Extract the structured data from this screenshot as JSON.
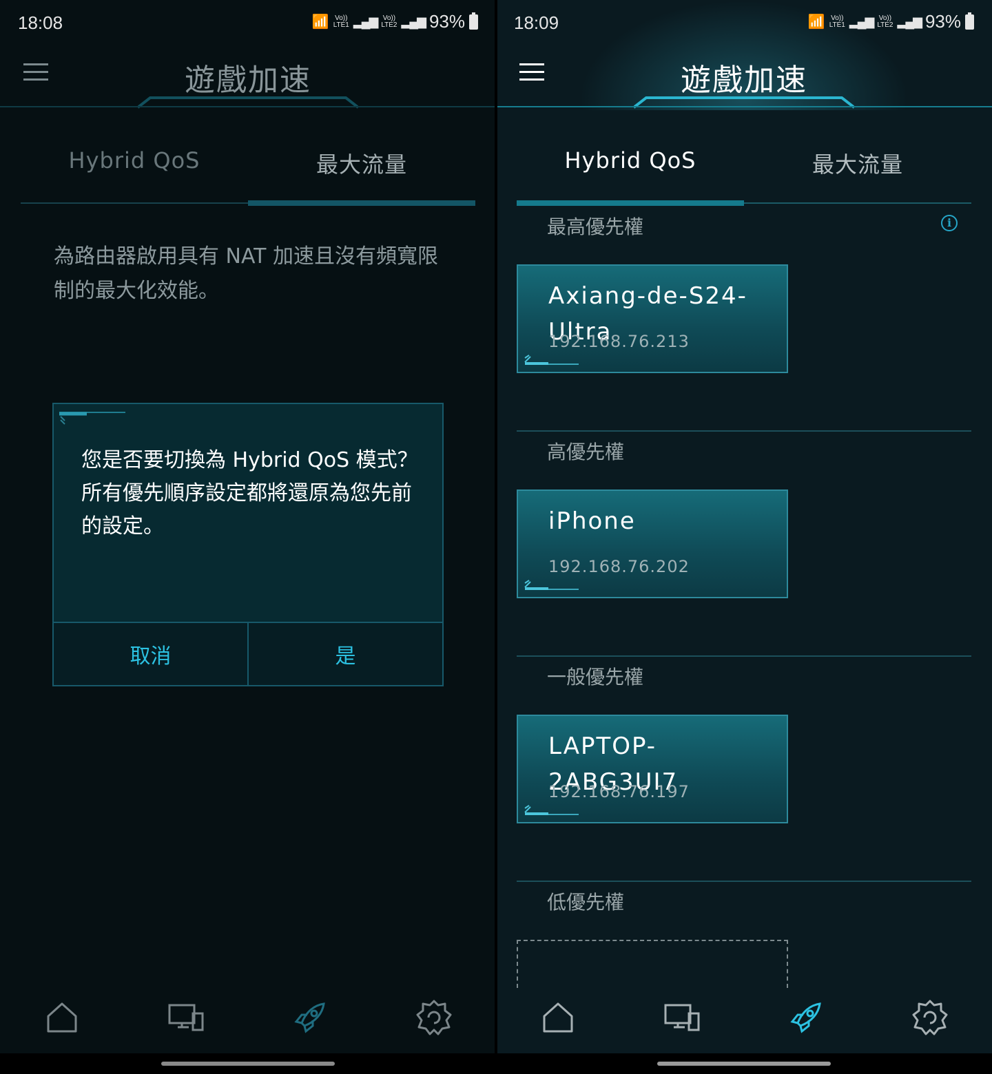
{
  "left": {
    "status": {
      "time": "18:08",
      "net1": [
        "Vo))",
        "LTE1"
      ],
      "net2": [
        "Vo))",
        "LTE2"
      ],
      "battery": "93%"
    },
    "header": {
      "title": "遊戲加速"
    },
    "tabs": [
      {
        "label": "Hybrid QoS"
      },
      {
        "label": "最大流量"
      }
    ],
    "active_tab": 1,
    "description": "為路由器啟用具有 NAT 加速且沒有頻寬限制的最大化效能。",
    "dialog": {
      "line1": "您是否要切換為 Hybrid QoS 模式？",
      "line2": "所有優先順序設定都將還原為您先前的設定。",
      "cancel": "取消",
      "confirm": "是"
    },
    "nav": {
      "icons": [
        "home-icon",
        "devices-icon",
        "rocket-icon",
        "gear-icon"
      ],
      "active": 2
    }
  },
  "right": {
    "status": {
      "time": "18:09",
      "net1": [
        "Vo))",
        "LTE1"
      ],
      "net2": [
        "Vo))",
        "LTE2"
      ],
      "battery": "93%"
    },
    "header": {
      "title": "遊戲加速"
    },
    "tabs": [
      {
        "label": "Hybrid QoS"
      },
      {
        "label": "最大流量"
      }
    ],
    "active_tab": 0,
    "sections": [
      {
        "label": "最高優先權",
        "device": {
          "name": "Axiang-de-S24-Ultra",
          "ip": "192.168.76.213"
        }
      },
      {
        "label": "高優先權",
        "device": {
          "name": "iPhone",
          "ip": "192.168.76.202"
        }
      },
      {
        "label": "一般優先權",
        "device": {
          "name": "LAPTOP-2ABG3UI7",
          "ip": "192.168.76.197"
        }
      },
      {
        "label": "低優先權"
      }
    ],
    "nav": {
      "icons": [
        "home-icon",
        "devices-icon",
        "rocket-icon",
        "gear-icon"
      ],
      "active": 2
    }
  },
  "colors": {
    "accent": "#2cc2e2",
    "card": "#166b78",
    "background": "#061013"
  }
}
